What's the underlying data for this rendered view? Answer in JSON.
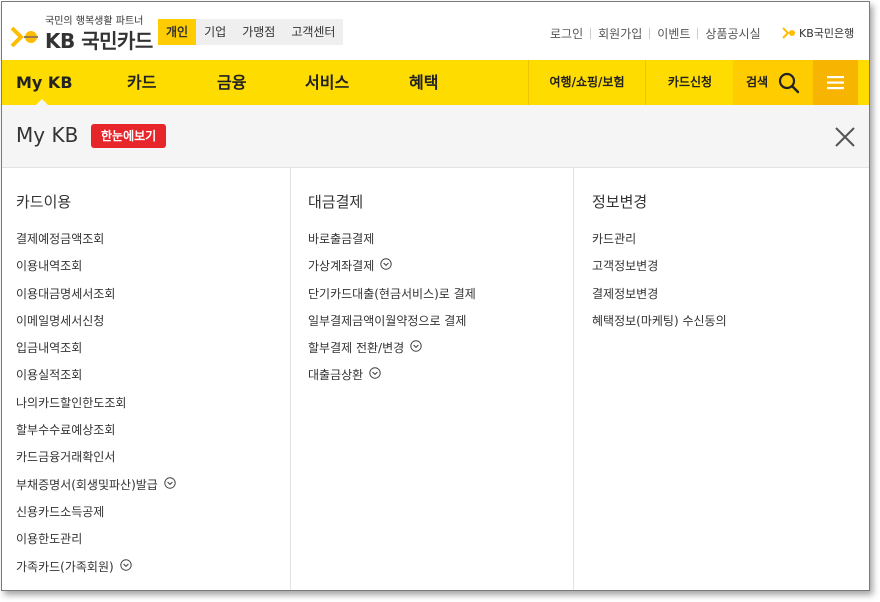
{
  "header": {
    "slogan": "국민의 행복생활 파트너",
    "brand": "KB 국민카드",
    "segments": [
      "개인",
      "기업",
      "가맹점",
      "고객센터"
    ],
    "active_segment": "개인",
    "utils": [
      "로그인",
      "회원가입",
      "이벤트",
      "상품공시실"
    ],
    "bank": "KB국민은행"
  },
  "gnb": {
    "menus": [
      "My KB",
      "카드",
      "금융",
      "서비스",
      "혜택"
    ],
    "subs": [
      "여행/쇼핑/보험",
      "카드신청"
    ],
    "search_label": "검색"
  },
  "panel": {
    "title": "My KB",
    "badge": "한눈에보기"
  },
  "columns": [
    {
      "heading": "카드이용",
      "items": [
        {
          "label": "결제예정금액조회",
          "expand": false
        },
        {
          "label": "이용내역조회",
          "expand": false
        },
        {
          "label": "이용대금명세서조회",
          "expand": false
        },
        {
          "label": "이메일명세서신청",
          "expand": false
        },
        {
          "label": "입금내역조회",
          "expand": false
        },
        {
          "label": "이용실적조회",
          "expand": false
        },
        {
          "label": "나의카드할인한도조회",
          "expand": false
        },
        {
          "label": "할부수수료예상조회",
          "expand": false
        },
        {
          "label": "카드금융거래확인서",
          "expand": false
        },
        {
          "label": "부채증명서(회생및파산)발급",
          "expand": true
        },
        {
          "label": "신용카드소득공제",
          "expand": false
        },
        {
          "label": "이용한도관리",
          "expand": false
        },
        {
          "label": "가족카드(가족회원)",
          "expand": true
        }
      ]
    },
    {
      "heading": "대금결제",
      "items": [
        {
          "label": "바로출금결제",
          "expand": false
        },
        {
          "label": "가상계좌결제",
          "expand": true
        },
        {
          "label": "단기카드대출(현금서비스)로 결제",
          "expand": false
        },
        {
          "label": "일부결제금액이월약정으로 결제",
          "expand": false
        },
        {
          "label": "할부결제 전환/변경",
          "expand": true
        },
        {
          "label": "대출금상환",
          "expand": true
        }
      ]
    },
    {
      "heading": "정보변경",
      "items": [
        {
          "label": "카드관리",
          "expand": false
        },
        {
          "label": "고객정보변경",
          "expand": false
        },
        {
          "label": "결제정보변경",
          "expand": false
        },
        {
          "label": "혜택정보(마케팅) 수신동의",
          "expand": false
        }
      ]
    }
  ],
  "colors": {
    "accent": "#ffdc00",
    "segment_active": "#ffcc00",
    "hamburger_bg": "#f7b400",
    "badge": "#e7262b"
  },
  "icons": [
    "kb-star-logo-icon",
    "search-icon",
    "hamburger-menu-icon",
    "close-icon",
    "chevron-down-circle-icon"
  ]
}
